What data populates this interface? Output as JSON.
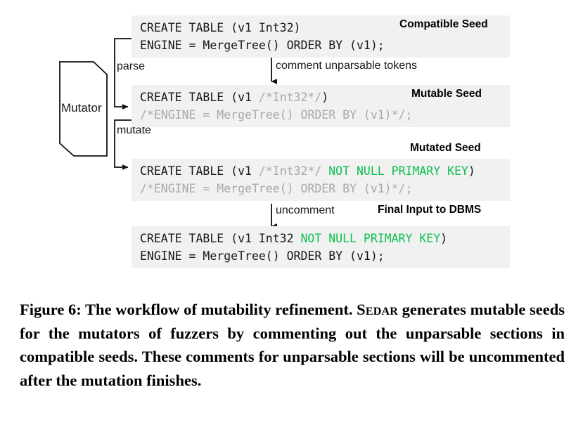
{
  "figure": {
    "mutator_box": {
      "label": "Mutator"
    },
    "flow_labels": {
      "parse": "parse",
      "mutate": "mutate",
      "comment": "comment unparsable tokens",
      "uncomment": "uncomment"
    },
    "blocks": [
      {
        "id": "compatible-seed",
        "title": "Compatible Seed",
        "title_inside": true,
        "lines": [
          [
            {
              "text": "CREATE TABLE (v1 Int32)",
              "style": "normal"
            }
          ],
          [
            {
              "text": "ENGINE = MergeTree() ORDER BY (v1);",
              "style": "normal"
            }
          ]
        ]
      },
      {
        "id": "mutable-seed",
        "title": "Mutable Seed",
        "title_inside": true,
        "lines": [
          [
            {
              "text": "CREATE TABLE (v1 ",
              "style": "normal"
            },
            {
              "text": "/*Int32*/",
              "style": "comment"
            },
            {
              "text": ")",
              "style": "normal"
            }
          ],
          [
            {
              "text": "/*ENGINE = MergeTree() ORDER BY (v1)*/;",
              "style": "comment"
            }
          ]
        ]
      },
      {
        "id": "mutated-seed",
        "title": "Mutated Seed",
        "title_inside": false,
        "lines": [
          [
            {
              "text": "CREATE TABLE (v1 ",
              "style": "normal"
            },
            {
              "text": "/*Int32*/",
              "style": "comment"
            },
            {
              "text": " ",
              "style": "normal"
            },
            {
              "text": "NOT NULL PRIMARY KEY",
              "style": "mutation"
            },
            {
              "text": ")",
              "style": "normal"
            }
          ],
          [
            {
              "text": "/*ENGINE = MergeTree() ORDER BY (v1)*/;",
              "style": "comment"
            }
          ]
        ]
      },
      {
        "id": "final-input",
        "title": "Final Input to DBMS",
        "title_inside": false,
        "lines": [
          [
            {
              "text": "CREATE TABLE (v1 Int32 ",
              "style": "normal"
            },
            {
              "text": "NOT NULL PRIMARY KEY",
              "style": "mutation"
            },
            {
              "text": ")",
              "style": "normal"
            }
          ],
          [
            {
              "text": "ENGINE = MergeTree() ORDER BY (v1);",
              "style": "normal"
            }
          ]
        ]
      }
    ],
    "colors": {
      "block_background": "#f1f1f1",
      "code_text": "#17171b",
      "comment_text": "#a8a8a8",
      "mutation_text": "#0dc04f",
      "stroke": "#111111"
    }
  },
  "caption": {
    "number": "Figure 6:",
    "part1": " The workflow of mutability refinement. ",
    "smallcaps": "Sedar",
    "part2": " generates mutable seeds for the mutators of fuzzers by commenting out the unparsable sections in compatible seeds. These comments for unparsable sections will be uncommented after the mutation finishes."
  }
}
